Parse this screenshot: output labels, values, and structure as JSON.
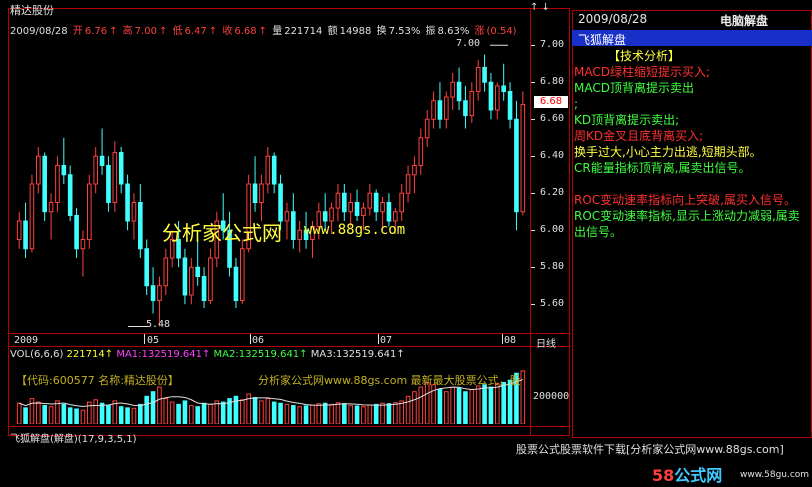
{
  "window": {
    "stock_name": "精达股份",
    "icons": "↑ ↓"
  },
  "status": {
    "date": "2009/08/28",
    "open_label": "开",
    "open": "6.76",
    "high_label": "高",
    "high": "7.00",
    "low_label": "低",
    "low": "6.47",
    "close_label": "收",
    "close": "6.68",
    "vol_label": "量",
    "vol": "221714",
    "amt_label": "额",
    "amt": "14988",
    "turn_label": "换",
    "turn": "7.53%",
    "amp_label": "振",
    "amp": "8.63%",
    "chg_label": "涨",
    "chg": "(0.54)"
  },
  "price_axis": [
    "7.00",
    "6.80",
    "6.60",
    "6.40",
    "6.20",
    "6.00",
    "5.80",
    "5.60"
  ],
  "current_price": "6.68",
  "high_marker": "7.00",
  "low_marker": "5.48",
  "time_axis": {
    "y2009": "2009",
    "m05": "05",
    "m06": "06",
    "m07": "07",
    "m08": "08",
    "period": "日线"
  },
  "volume": {
    "header_label": "VOL(6,6,6)",
    "value": "221714",
    "ma1": "MA1:132519.641",
    "ma2": "MA2:132519.641",
    "ma3": "MA3:132519.641",
    "axis": "200000"
  },
  "code_line": "【代码:600577 名称:精达股份】",
  "watermark_line": "分析家公式网www.88gs.com 最新最大股票公式，股",
  "indicator_label": "飞狐解盘(解盘)(17,9,3,5,1)",
  "watermark_main": "分析家公式网",
  "watermark_url": "www.88gs.com",
  "side": {
    "date": "2009/08/28",
    "brand": "电脑解盘",
    "title": "飞狐解盘",
    "lines": [
      {
        "text": "【技术分析】",
        "color": "#ffff40"
      },
      {
        "text": "MACD绿柱缩短提示买入;",
        "color": "#ff3030"
      },
      {
        "text": "MACD顶背离提示卖出",
        "color": "#40ff40"
      },
      {
        "text": ";",
        "color": "#40ff40"
      },
      {
        "text": "KD顶背离提示卖出;",
        "color": "#40ff40"
      },
      {
        "text": "周KD金叉且底背离买入;",
        "color": "#ff3030"
      },
      {
        "text": "换手过大,小心主力出逃,短期头部。",
        "color": "#ffff40"
      },
      {
        "text": "CR能量指标顶背离,属卖出信号。",
        "color": "#40ff40"
      },
      {
        "text": "ROC变动速率指标向上突破,属买入信号。",
        "color": "#ff3030"
      },
      {
        "text": "ROC变动速率指标,显示上涨动力减弱,属卖出信号。",
        "color": "#40ff40"
      }
    ]
  },
  "download_link": "股票公式股票软件下载[分析家公式网www.88gs.com]",
  "logo": {
    "num": "58",
    "text": "公式网",
    "url": "www.58gu.com"
  },
  "colors": {
    "up": "#ff4040",
    "down": "#40ffff",
    "border": "#b00000",
    "panel_title": "#1830c8"
  },
  "candles": [
    [
      5.95,
      6.1,
      5.9,
      6.05
    ],
    [
      6.05,
      6.15,
      5.85,
      5.9
    ],
    [
      5.9,
      6.3,
      5.88,
      6.25
    ],
    [
      6.25,
      6.45,
      6.2,
      6.4
    ],
    [
      6.4,
      6.42,
      6.05,
      6.1
    ],
    [
      6.1,
      6.2,
      5.95,
      6.15
    ],
    [
      6.15,
      6.4,
      6.1,
      6.35
    ],
    [
      6.35,
      6.5,
      6.25,
      6.3
    ],
    [
      6.3,
      6.35,
      6.05,
      6.08
    ],
    [
      6.08,
      6.12,
      5.85,
      5.9
    ],
    [
      5.9,
      6.0,
      5.75,
      5.95
    ],
    [
      5.95,
      6.3,
      5.9,
      6.25
    ],
    [
      6.25,
      6.45,
      6.2,
      6.4
    ],
    [
      6.4,
      6.55,
      6.3,
      6.35
    ],
    [
      6.35,
      6.4,
      6.1,
      6.15
    ],
    [
      6.15,
      6.48,
      6.1,
      6.42
    ],
    [
      6.42,
      6.45,
      6.2,
      6.25
    ],
    [
      6.25,
      6.3,
      6.0,
      6.05
    ],
    [
      6.05,
      6.2,
      5.95,
      6.15
    ],
    [
      6.15,
      6.25,
      5.85,
      5.9
    ],
    [
      5.9,
      5.95,
      5.65,
      5.7
    ],
    [
      5.7,
      5.8,
      5.55,
      5.62
    ],
    [
      5.62,
      5.75,
      5.48,
      5.7
    ],
    [
      5.7,
      5.9,
      5.65,
      5.85
    ],
    [
      5.85,
      6.0,
      5.8,
      5.95
    ],
    [
      5.95,
      6.05,
      5.8,
      5.85
    ],
    [
      5.85,
      5.9,
      5.6,
      5.65
    ],
    [
      5.65,
      5.85,
      5.6,
      5.8
    ],
    [
      5.8,
      5.95,
      5.7,
      5.75
    ],
    [
      5.75,
      5.8,
      5.58,
      5.62
    ],
    [
      5.62,
      5.9,
      5.6,
      5.85
    ],
    [
      5.85,
      6.1,
      5.8,
      6.05
    ],
    [
      6.05,
      6.2,
      5.95,
      6.0
    ],
    [
      6.0,
      6.1,
      5.75,
      5.8
    ],
    [
      5.8,
      5.85,
      5.58,
      5.62
    ],
    [
      5.62,
      5.95,
      5.6,
      5.9
    ],
    [
      5.9,
      6.3,
      5.88,
      6.25
    ],
    [
      6.25,
      6.4,
      6.1,
      6.15
    ],
    [
      6.15,
      6.3,
      6.05,
      6.25
    ],
    [
      6.25,
      6.45,
      6.2,
      6.4
    ],
    [
      6.4,
      6.42,
      6.2,
      6.25
    ],
    [
      6.25,
      6.3,
      6.0,
      6.05
    ],
    [
      6.05,
      6.15,
      5.95,
      6.1
    ],
    [
      6.1,
      6.2,
      5.9,
      5.95
    ],
    [
      5.95,
      6.05,
      5.88,
      6.0
    ],
    [
      6.0,
      6.1,
      5.9,
      5.95
    ],
    [
      5.95,
      6.05,
      5.85,
      6.02
    ],
    [
      6.02,
      6.15,
      5.95,
      6.1
    ],
    [
      6.1,
      6.2,
      6.0,
      6.05
    ],
    [
      6.05,
      6.15,
      5.98,
      6.12
    ],
    [
      6.12,
      6.25,
      6.05,
      6.2
    ],
    [
      6.2,
      6.25,
      6.05,
      6.1
    ],
    [
      6.1,
      6.2,
      6.02,
      6.15
    ],
    [
      6.15,
      6.22,
      6.05,
      6.08
    ],
    [
      6.08,
      6.15,
      6.0,
      6.12
    ],
    [
      6.12,
      6.25,
      6.08,
      6.2
    ],
    [
      6.2,
      6.22,
      6.05,
      6.1
    ],
    [
      6.1,
      6.18,
      6.0,
      6.15
    ],
    [
      6.15,
      6.2,
      6.02,
      6.05
    ],
    [
      6.05,
      6.12,
      5.98,
      6.1
    ],
    [
      6.1,
      6.25,
      6.05,
      6.2
    ],
    [
      6.2,
      6.35,
      6.15,
      6.3
    ],
    [
      6.3,
      6.4,
      6.2,
      6.35
    ],
    [
      6.35,
      6.55,
      6.3,
      6.5
    ],
    [
      6.5,
      6.65,
      6.45,
      6.6
    ],
    [
      6.6,
      6.75,
      6.55,
      6.7
    ],
    [
      6.7,
      6.8,
      6.55,
      6.6
    ],
    [
      6.6,
      6.75,
      6.55,
      6.72
    ],
    [
      6.72,
      6.85,
      6.65,
      6.8
    ],
    [
      6.8,
      6.88,
      6.65,
      6.7
    ],
    [
      6.7,
      6.78,
      6.55,
      6.62
    ],
    [
      6.62,
      6.8,
      6.58,
      6.75
    ],
    [
      6.75,
      6.92,
      6.7,
      6.88
    ],
    [
      6.88,
      6.95,
      6.75,
      6.8
    ],
    [
      6.8,
      6.85,
      6.6,
      6.65
    ],
    [
      6.65,
      6.8,
      6.6,
      6.78
    ],
    [
      6.78,
      6.9,
      6.7,
      6.75
    ],
    [
      6.75,
      6.8,
      6.55,
      6.6
    ],
    [
      6.6,
      6.7,
      6.0,
      6.1
    ],
    [
      6.1,
      6.75,
      6.08,
      6.68
    ]
  ],
  "volumes": [
    90,
    70,
    110,
    95,
    80,
    75,
    100,
    85,
    70,
    65,
    60,
    95,
    105,
    90,
    80,
    100,
    75,
    70,
    68,
    85,
    120,
    140,
    160,
    110,
    95,
    85,
    100,
    80,
    75,
    90,
    85,
    100,
    95,
    110,
    120,
    105,
    130,
    115,
    100,
    110,
    95,
    90,
    85,
    80,
    75,
    78,
    82,
    88,
    90,
    85,
    92,
    88,
    80,
    78,
    75,
    82,
    85,
    90,
    88,
    92,
    100,
    120,
    140,
    160,
    180,
    170,
    150,
    140,
    160,
    155,
    140,
    150,
    165,
    170,
    160,
    175,
    180,
    190,
    220,
    230
  ]
}
